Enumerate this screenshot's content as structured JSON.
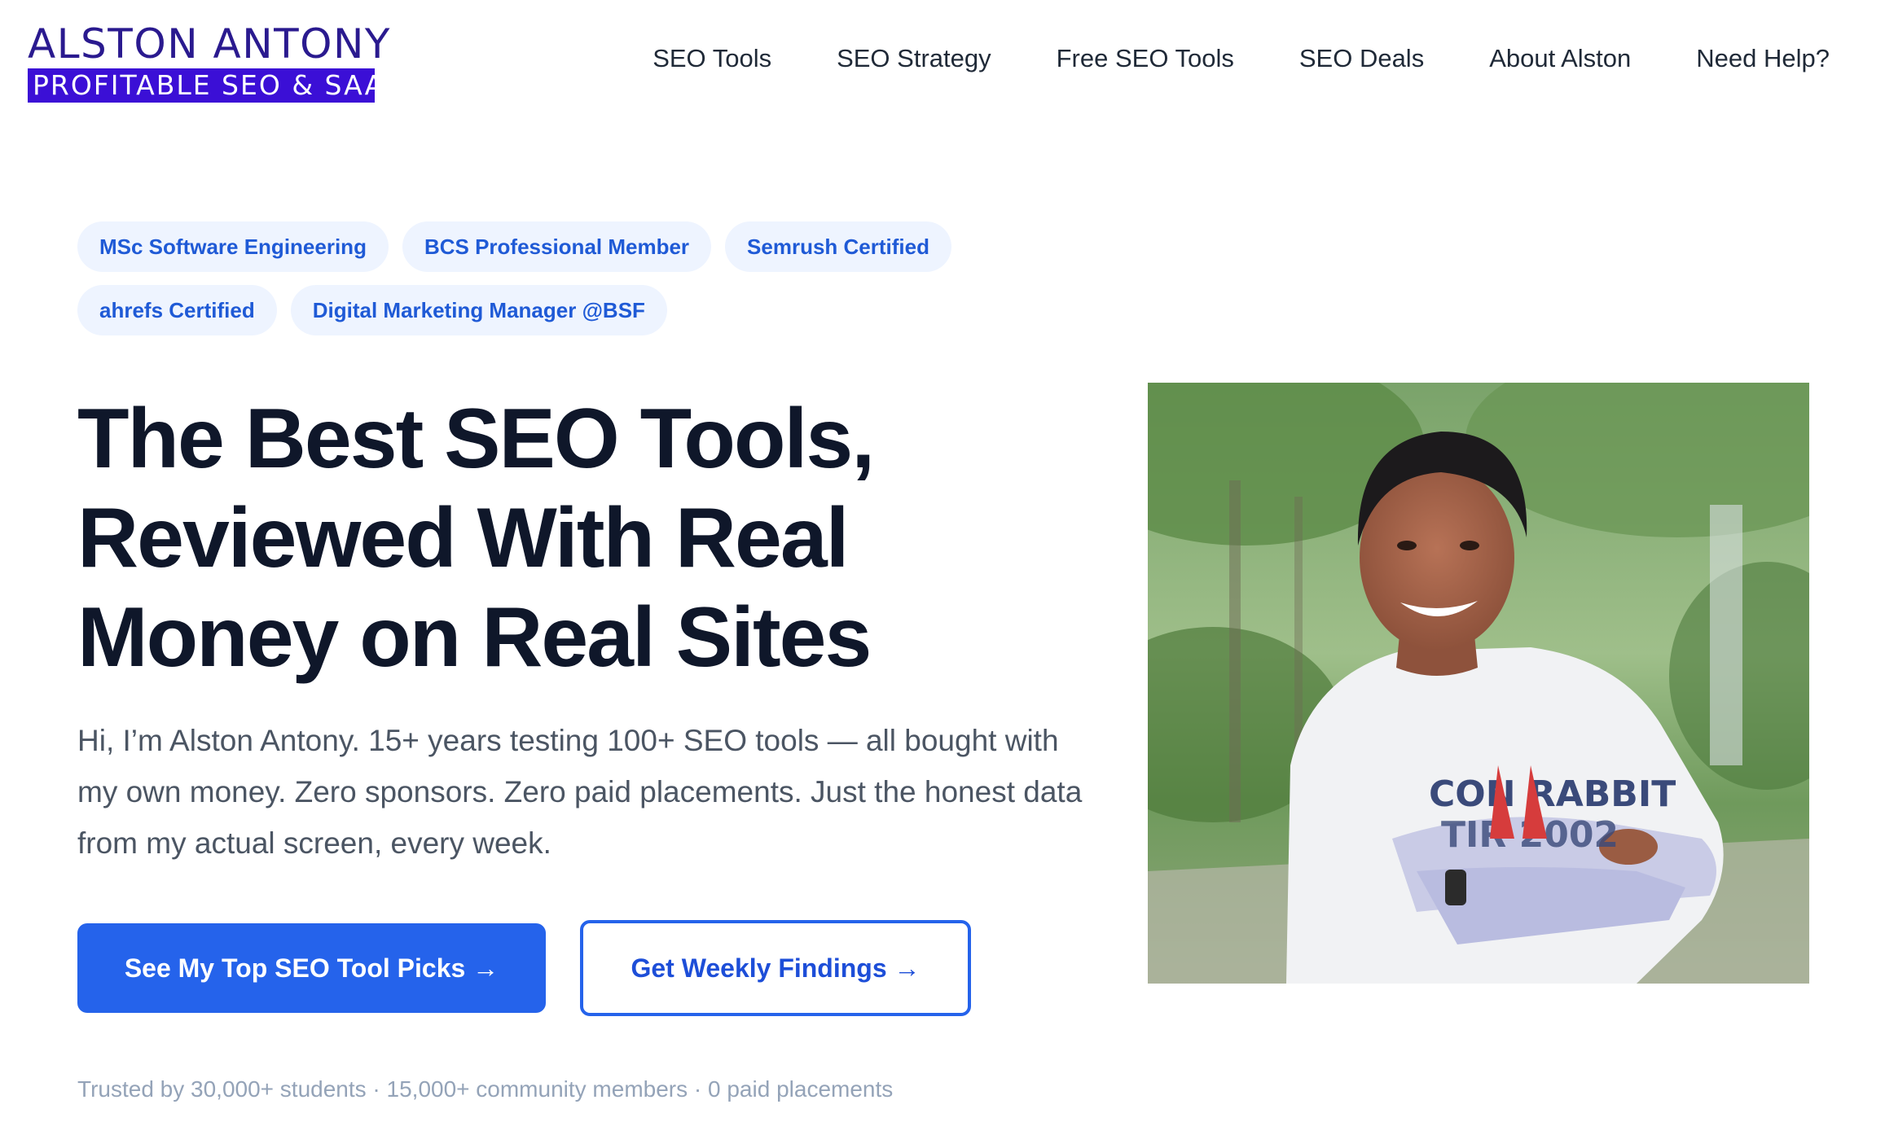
{
  "logo": {
    "title": "ALSTON ANTONY",
    "tagline": "PROFITABLE SEO & SAAS",
    "brand_color": "#3b0fd6"
  },
  "nav": {
    "items": [
      {
        "label": "SEO Tools"
      },
      {
        "label": "SEO Strategy"
      },
      {
        "label": "Free SEO Tools"
      },
      {
        "label": "SEO Deals"
      },
      {
        "label": "About Alston"
      },
      {
        "label": "Need Help?"
      }
    ]
  },
  "badges": [
    {
      "label": "MSc Software Engineering"
    },
    {
      "label": "BCS Professional Member"
    },
    {
      "label": "Semrush Certified"
    },
    {
      "label": "ahrefs Certified"
    },
    {
      "label": "Digital Marketing Manager @BSF"
    }
  ],
  "hero": {
    "headline_line1": "The Best SEO Tools,",
    "headline_line2": "Reviewed With Real",
    "headline_line3": "Money on Real Sites",
    "intro": "Hi, I’m Alston Antony. 15+ years testing 100+ SEO tools — all bought with my own money. Zero sponsors. Zero paid placements. Just the honest data from my actual screen, every week.",
    "primary_cta": "See My Top SEO Tool Picks →",
    "secondary_cta": "Get Weekly Findings →",
    "trust_line": "Trusted by 30,000+ students · 15,000+ community members · 0 paid placements",
    "accent_color": "#2563eb"
  },
  "photo": {
    "shirt_text_1": "CON RABBIT",
    "shirt_text_2": "TIR 2002"
  }
}
